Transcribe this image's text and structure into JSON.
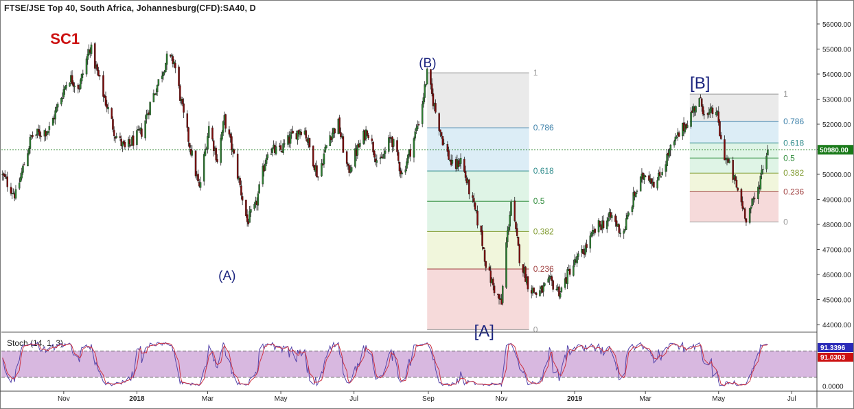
{
  "title": "FTSE/JSE Top 40, South Africa, Johannesburg(CFD):SA40, D",
  "stoch_title": "Stoch (14, 1, 3)",
  "colors": {
    "up": "#2e7d32",
    "down": "#7b0c0c",
    "fib_gray": "#e6e6e6",
    "fib_blue": "#d6eaf5",
    "fib_green": "#d9f2e2",
    "fib_yellow": "#eef5d6",
    "fib_red": "#f5d3d3",
    "stoch_band": "#d8b8e0",
    "stoch_k": "#5544aa",
    "stoch_d": "#cc3344",
    "last_price_line": "#1a7a1a",
    "wave_label": "#1a237e",
    "sc1_label": "#cc1111"
  },
  "chart_data": [
    {
      "type": "candlestick",
      "title": "FTSE/JSE Top 40, South Africa, Johannesburg(CFD):SA40, D",
      "ylim": [
        43700,
        56300
      ],
      "y_ticks": [
        "56000.00",
        "55000.00",
        "54000.00",
        "53000.00",
        "52000.00",
        "51000.00",
        "50000.00",
        "49000.00",
        "48000.00",
        "47000.00",
        "46000.00",
        "45000.00",
        "44000.00"
      ],
      "x_ticks": [
        "Nov",
        "2018",
        "Mar",
        "May",
        "Jul",
        "Sep",
        "Nov",
        "2019",
        "Mar",
        "May",
        "Jul"
      ],
      "x_range": [
        "2017-09-10",
        "2019-07-22"
      ],
      "last_price": 50980,
      "last_price_label": "50980.00",
      "grid": false,
      "anchor_path": [
        [
          "2017-09-10",
          50000
        ],
        [
          "2017-09-22",
          49150
        ],
        [
          "2017-10-05",
          51500
        ],
        [
          "2017-10-20",
          51800
        ],
        [
          "2017-11-05",
          53900
        ],
        [
          "2017-11-14",
          53500
        ],
        [
          "2017-11-23",
          55100
        ],
        [
          "2017-12-01",
          53700
        ],
        [
          "2017-12-14",
          51600
        ],
        [
          "2017-12-22",
          51000
        ],
        [
          "2018-01-05",
          51700
        ],
        [
          "2018-01-12",
          52800
        ],
        [
          "2018-01-26",
          54600
        ],
        [
          "2018-02-01",
          54500
        ],
        [
          "2018-02-09",
          52300
        ],
        [
          "2018-02-22",
          49400
        ],
        [
          "2018-03-02",
          51900
        ],
        [
          "2018-03-09",
          50600
        ],
        [
          "2018-03-15",
          52200
        ],
        [
          "2018-03-23",
          50700
        ],
        [
          "2018-04-03",
          48100
        ],
        [
          "2018-04-10",
          48700
        ],
        [
          "2018-04-20",
          51000
        ],
        [
          "2018-04-30",
          50900
        ],
        [
          "2018-05-10",
          51500
        ],
        [
          "2018-05-20",
          51900
        ],
        [
          "2018-06-01",
          49900
        ],
        [
          "2018-06-10",
          51500
        ],
        [
          "2018-06-18",
          52000
        ],
        [
          "2018-06-26",
          50100
        ],
        [
          "2018-07-02",
          50800
        ],
        [
          "2018-07-12",
          51800
        ],
        [
          "2018-07-22",
          50300
        ],
        [
          "2018-08-01",
          51500
        ],
        [
          "2018-08-10",
          50000
        ],
        [
          "2018-08-18",
          51100
        ],
        [
          "2018-08-25",
          52300
        ],
        [
          "2018-08-31",
          54000
        ],
        [
          "2018-09-07",
          52500
        ],
        [
          "2018-09-14",
          51200
        ],
        [
          "2018-09-22",
          50200
        ],
        [
          "2018-09-28",
          50600
        ],
        [
          "2018-10-06",
          49200
        ],
        [
          "2018-10-14",
          47800
        ],
        [
          "2018-10-20",
          46200
        ],
        [
          "2018-10-27",
          45300
        ],
        [
          "2018-11-01",
          44800
        ],
        [
          "2018-11-04",
          46800
        ],
        [
          "2018-11-09",
          48900
        ],
        [
          "2018-11-16",
          46700
        ],
        [
          "2018-11-24",
          45500
        ],
        [
          "2018-12-01",
          45200
        ],
        [
          "2018-12-12",
          45700
        ],
        [
          "2018-12-20",
          45300
        ],
        [
          "2018-12-28",
          46200
        ],
        [
          "2019-01-08",
          46900
        ],
        [
          "2019-01-20",
          47900
        ],
        [
          "2019-02-01",
          48300
        ],
        [
          "2019-02-10",
          47600
        ],
        [
          "2019-02-20",
          49200
        ],
        [
          "2019-03-01",
          50100
        ],
        [
          "2019-03-10",
          49600
        ],
        [
          "2019-03-20",
          50800
        ],
        [
          "2019-03-28",
          51500
        ],
        [
          "2019-04-07",
          52300
        ],
        [
          "2019-04-14",
          53000
        ],
        [
          "2019-04-22",
          52300
        ],
        [
          "2019-04-29",
          52600
        ],
        [
          "2019-05-04",
          51000
        ],
        [
          "2019-05-11",
          50200
        ],
        [
          "2019-05-18",
          49200
        ],
        [
          "2019-05-24",
          48300
        ],
        [
          "2019-06-02",
          49200
        ],
        [
          "2019-06-08",
          50600
        ],
        [
          "2019-06-11",
          50980
        ]
      ]
    },
    {
      "type": "fibonacci_retracement",
      "name": "(B)-[A]",
      "start": "2018-08-31",
      "end": "2018-11-24",
      "high": 54050,
      "low": 43800,
      "levels": [
        {
          "ratio": 1,
          "label": "1",
          "color": "#999999"
        },
        {
          "ratio": 0.786,
          "label": "0.786",
          "color": "#3a7fa8"
        },
        {
          "ratio": 0.618,
          "label": "0.618",
          "color": "#2e8b8b"
        },
        {
          "ratio": 0.5,
          "label": "0.5",
          "color": "#2e8b3a"
        },
        {
          "ratio": 0.382,
          "label": "0.382",
          "color": "#7f9a2e"
        },
        {
          "ratio": 0.236,
          "label": "0.236",
          "color": "#a04040"
        },
        {
          "ratio": 0,
          "label": "0",
          "color": "#999999"
        }
      ]
    },
    {
      "type": "fibonacci_retracement",
      "name": "[B]",
      "start": "2019-04-07",
      "end": "2019-06-20",
      "high": 53200,
      "low": 48100,
      "levels": [
        {
          "ratio": 1,
          "label": "1",
          "color": "#999999"
        },
        {
          "ratio": 0.786,
          "label": "0.786",
          "color": "#3a7fa8"
        },
        {
          "ratio": 0.618,
          "label": "0.618",
          "color": "#2e8b8b"
        },
        {
          "ratio": 0.5,
          "label": "0.5",
          "color": "#2e8b3a"
        },
        {
          "ratio": 0.382,
          "label": "0.382",
          "color": "#7f9a2e"
        },
        {
          "ratio": 0.236,
          "label": "0.236",
          "color": "#a04040"
        },
        {
          "ratio": 0,
          "label": "0",
          "color": "#999999"
        }
      ]
    },
    {
      "type": "annotations",
      "items": [
        {
          "label": "SC1",
          "date": "2017-11-23",
          "value": 55100,
          "style": "sc1",
          "position": "above-left"
        },
        {
          "label": "(A)",
          "date": "2018-04-03",
          "value": 46500,
          "style": "wave",
          "position": "below-left"
        },
        {
          "label": "(B)",
          "date": "2018-08-31",
          "value": 54050,
          "style": "wave",
          "position": "above"
        },
        {
          "label": "[A]",
          "date": "2018-11-01",
          "value": 43800,
          "style": "wave",
          "position": "below-left"
        },
        {
          "label": "[B]",
          "date": "2019-04-14",
          "value": 53200,
          "style": "wave",
          "position": "above"
        }
      ]
    },
    {
      "type": "stochastic",
      "title": "Stoch (14, 1, 3)",
      "ylim": [
        -12,
        120
      ],
      "band": [
        20,
        80
      ],
      "y_ticks": [
        "0.0000"
      ],
      "k_label": "91.3396",
      "d_label": "91.0303",
      "k_color": "#2a2ab8",
      "d_color": "#cc1111"
    }
  ]
}
